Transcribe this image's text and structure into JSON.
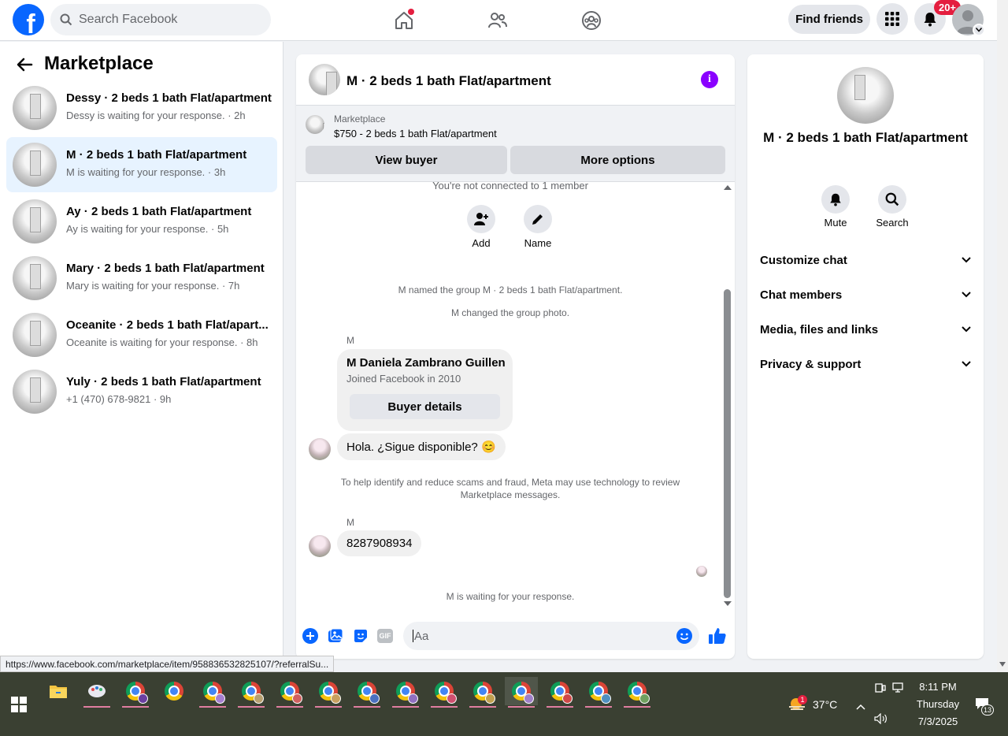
{
  "topbar": {
    "search_placeholder": "Search Facebook",
    "find_friends": "Find friends",
    "notif_badge": "20+",
    "logo_letter": "f"
  },
  "sidebar": {
    "title": "Marketplace",
    "conversations": [
      {
        "title": "Dessy · 2 beds 1 bath Flat/apartment",
        "sub": "Dessy is waiting for your response. · 2h"
      },
      {
        "title": "M · 2 beds 1 bath Flat/apartment",
        "sub": "M is waiting for your response. · 3h",
        "active": true
      },
      {
        "title": "Ay · 2 beds 1 bath Flat/apartment",
        "sub": "Ay is waiting for your response. · 5h"
      },
      {
        "title": "Mary · 2 beds 1 bath Flat/apartment",
        "sub": "Mary is waiting for your response. · 7h"
      },
      {
        "title": "Oceanite · 2 beds 1 bath Flat/apart...",
        "sub": "Oceanite is waiting for your response. · 8h"
      },
      {
        "title": "Yuly · 2 beds 1 bath Flat/apartment",
        "sub": "+1 (470) 678-9821 · 9h"
      }
    ]
  },
  "chat": {
    "title": "M · 2 beds 1 bath Flat/apartment",
    "marketplace_label": "Marketplace",
    "item": "$750 - 2 beds 1 bath Flat/apartment",
    "view_buyer": "View buyer",
    "more_options": "More options",
    "not_connected": "You're not connected to 1 member",
    "add_label": "Add",
    "name_label": "Name",
    "sys_named": "M named the group M · 2 beds 1 bath Flat/apartment.",
    "sys_photo": "M changed the group photo.",
    "sender1": "M",
    "card_name": "M Daniela Zambrano Guillen",
    "card_joined": "Joined Facebook in 2010",
    "buyer_details": "Buyer details",
    "msg1": "Hola. ¿Sigue disponible? 😊",
    "scam_notice": "To help identify and reduce scams and fraud, Meta may use technology to review Marketplace messages.",
    "sender2": "M",
    "msg2": "8287908934",
    "waiting": "M is waiting for your response.",
    "composer_placeholder": "Aa",
    "gif_label": "GIF"
  },
  "details": {
    "title": "M · 2 beds 1 bath Flat/apartment",
    "mute": "Mute",
    "search": "Search",
    "sections": [
      "Customize chat",
      "Chat members",
      "Media, files and links",
      "Privacy & support"
    ]
  },
  "status_url": "https://www.facebook.com/marketplace/item/958836532825107/?referralSu...",
  "taskbar": {
    "weather": "37°C",
    "weather_badge": "1",
    "time": "8:11 PM",
    "day": "Thursday",
    "date": "7/3/2025",
    "notif_count": "13"
  },
  "colors": {
    "brand": "#0866ff",
    "active_row": "#e7f3ff",
    "badge_red": "#e41e3f",
    "info_purple": "#8a00ff"
  }
}
